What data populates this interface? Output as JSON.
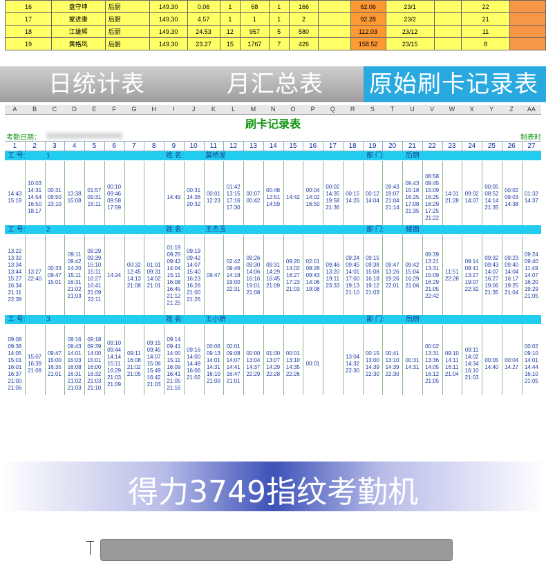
{
  "top_table": {
    "rows": [
      [
        "16",
        "盘守坤",
        "后厨",
        "149.30",
        "0.06",
        "1",
        "68",
        "1",
        "166",
        "",
        "62.06",
        "23/1",
        "",
        "22",
        ""
      ],
      [
        "17",
        "蒙进康",
        "后厨",
        "149.30",
        "4.57",
        "1",
        "1",
        "1",
        "2",
        "",
        "92.28",
        "23/2",
        "",
        "21",
        ""
      ],
      [
        "18",
        "江雄辉",
        "后厨",
        "149.30",
        "24.53",
        "12",
        "957",
        "5",
        "580",
        "",
        "112.03",
        "23/12",
        "",
        "11",
        ""
      ],
      [
        "19",
        "黄格凤",
        "后厨",
        "149.30",
        "23.27",
        "15",
        "1767",
        "7",
        "426",
        "",
        "158.52",
        "23/15",
        "",
        "8",
        ""
      ]
    ]
  },
  "tabs": [
    {
      "label": "日统计表",
      "active": false
    },
    {
      "label": "月汇总表",
      "active": false
    },
    {
      "label": "原始刷卡记录表",
      "active": true
    }
  ],
  "sheet": {
    "columns": [
      "A",
      "B",
      "C",
      "D",
      "E",
      "F",
      "G",
      "H",
      "I",
      "J",
      "K",
      "L",
      "M",
      "N",
      "O",
      "P",
      "Q",
      "R",
      "S",
      "T",
      "U",
      "V",
      "W",
      "X",
      "Y",
      "Z",
      "AA"
    ],
    "title": "刷卡记录表",
    "date_label": "考勤日期：",
    "maker_label": "制表时",
    "days": [
      "1",
      "2",
      "3",
      "4",
      "5",
      "6",
      "7",
      "8",
      "9",
      "10",
      "11",
      "12",
      "13",
      "14",
      "15",
      "16",
      "17",
      "18",
      "19",
      "20",
      "21",
      "22",
      "23",
      "24",
      "25",
      "26",
      "27"
    ],
    "employees": [
      {
        "id_label": "工 号:",
        "id": "1",
        "name_label": "姓 名:",
        "name": "莫桥发",
        "dept_label": "部 门:",
        "dept": "后厨",
        "cells": [
          "14:43\n15:19",
          "10:03\n14:31\n14:54\n16:50\n18:17",
          "00:31\n09:50\n23:10",
          "13:38\n15:08",
          "01:57\n09:31\n15:11",
          "00:10\n09:46\n09:58\n17:59",
          "",
          "",
          "14:49",
          "00:31\n14:36\n20:32",
          "00:01\n12:23",
          "01:42\n13:15\n17:16\n17:30",
          "00:07\n00:42",
          "00:48\n12:51\n14:59",
          "14:42",
          "00:04\n14:02\n16:50",
          "00:02\n14:35\n19:58\n21:36",
          "00:15\n14:26",
          "00:12\n14:04",
          "09:43\n19:07\n21:04\n21:14",
          "09:43\n15:18\n16:25\n17:08\n21:35",
          "08:58\n09:45\n15:09\n16:25\n16:29\n17:25\n21:22",
          "14:31\n21:28",
          "09:02\n14:07",
          "00:05\n08:52\n14:14\n21:35",
          "00:02\n09:03\n14:38",
          "01:32\n14:37"
        ]
      },
      {
        "id_label": "工 号:",
        "id": "2",
        "name_label": "姓 名:",
        "name": "王杰玉",
        "dept_label": "部 门:",
        "dept": "楼面",
        "cells": [
          "13:22\n13:32\n13:34\n13:44\n15:27\n16:34\n21:11\n22:38",
          "13:27\n22:40",
          "00:33\n09:47\n15:01",
          "09:11\n09:42\n14:20\n15:11\n16:31\n21:02\n21:03",
          "09:29\n09:39\n15:10\n15:11\n16:27\n16:41\n21:09\n22:11",
          "14:24",
          "00:32\n12:45\n14:13\n21:08",
          "01:01\n09:31\n14:02\n21:01",
          "01:19\n09:25\n09:42\n14:04\n15:11\n16:08\n16:45\n21:12\n21:25",
          "09:19\n09:42\n14:07\n15:40\n16:23\n16:26\n21:00\n21:26",
          "09:47",
          "02:42\n09:46\n14:18\n19:00\n22:31",
          "09:26\n09:30\n14:06\n16:16\n19:01\n21:08",
          "09:31\n14:29\n16:45\n21:09",
          "09:20\n14:02\n16:27\n17:23\n21:03",
          "02:01\n09:28\n09:43\n14:06\n19:08",
          "09:46\n13:20\n19:11\n23:33",
          "09:24\n09:45\n14:01\n17:00\n19:13\n21:10",
          "09:15\n09:38\n15:08\n16:18\n19:12\n21:03",
          "09:47\n13:26\n19:26\n22:01",
          "09:42\n15:04\n16:29\n21:06",
          "09:39\n13:21\n13:31\n15:09\n16:29\n21:05\n22:42",
          "11:51\n22:28",
          "09:14\n09:41\n13:27\n19:07\n22:32",
          "09:32\n09:43\n14:07\n16:27\n19:06\n21:35",
          "09:23\n09:40\n14:04\n16:17\n19:25\n21:04",
          "09:24\n09:40\n11:49\n14:07\n16:20\n19:29\n21:05"
        ]
      },
      {
        "id_label": "工 号:",
        "id": "3",
        "name_label": "姓 名:",
        "name": "王小娇",
        "dept_label": "部 门:",
        "dept": "后厨",
        "cells": [
          "09:08\n09:38\n14:05\n15:01\n16:01\n16:37\n21:00\n21:06",
          "15:07\n16:39\n21:09",
          "09:47\n15:00\n16:35\n21:01",
          "09:16\n09:43\n14:01\n15:03\n16:08\n16:31\n21:02\n21:03",
          "09:18\n09:39\n14:00\n15:01\n16:00\n16:32\n21:03\n21:10",
          "09:10\n09:44\n14:14\n15:11\n16:29\n21:03\n21:09",
          "09:11\n16:08\n21:02\n21:05",
          "09:15\n09:45\n14:07\n15:08\n15:49\n16:42\n21:03",
          "09:14\n09:41\n14:00\n15:11\n16:09\n16:41\n21:05\n21:16",
          "09:16\n14:00\n14:48\n16:06\n21:02",
          "00:06\n09:13\n14:01\n14:31\n16:10\n21:00",
          "00:01\n09:08\n14:07\n14:41\n16:47\n21:01",
          "00:00\n13:04\n14:37\n22:29",
          "01:00\n13:07\n14:29\n22:28",
          "00:01\n13:10\n14:35\n22:26",
          "00:01",
          "",
          "13:04\n14:32\n22:30",
          "00:15\n13:00\n14:39\n22:30",
          "00:41\n13:10\n14:39\n22:30",
          "00:31\n14:31",
          "00:02\n13:31\n13:36\n14:05\n16:12\n21:05",
          "09:10\n14:11\n16:11\n21:04",
          "09:11\n14:02\n14:34\n16:10\n21:03",
          "00:05\n14:40",
          "00:04\n14:27",
          "00:02\n09:10\n14:01\n14:44\n16:10\n21:05"
        ]
      }
    ]
  },
  "banner": {
    "text": "得力3749指纹考勤机"
  },
  "colors": {
    "tab_active": "#2aa9e0",
    "employee_bar": "#22ccee",
    "accent_green": "#129412",
    "banner_blue": "#3d52b8"
  }
}
